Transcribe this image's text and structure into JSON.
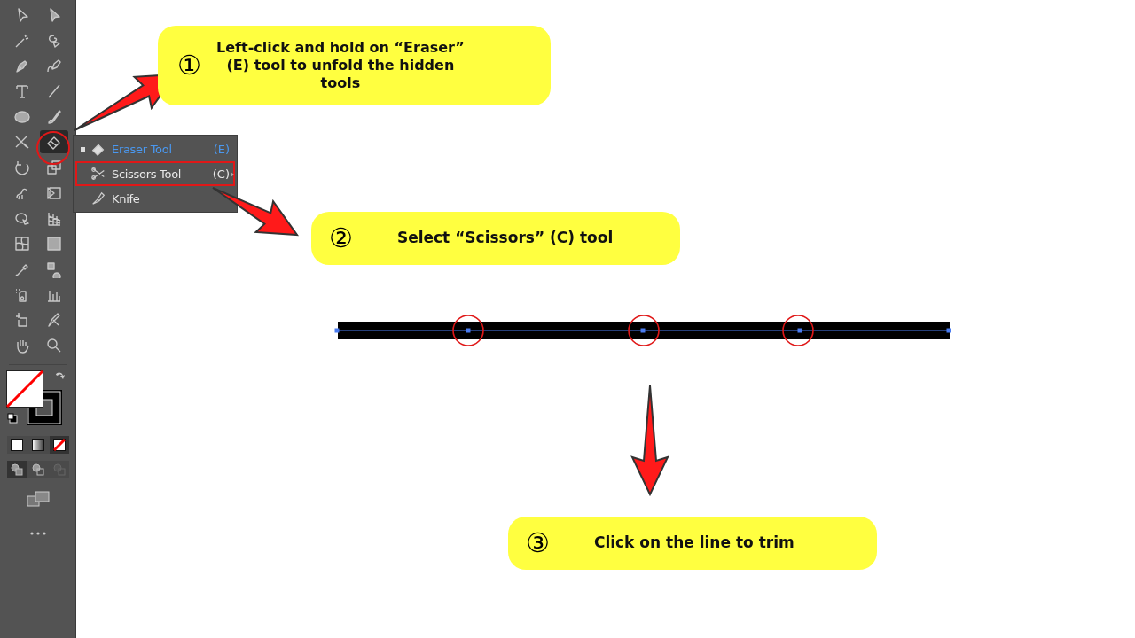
{
  "toolbar": {
    "tools": [
      {
        "kind": "select",
        "selected": false
      },
      {
        "kind": "direct-select",
        "selected": false
      },
      {
        "kind": "wand",
        "selected": false
      },
      {
        "kind": "lasso",
        "selected": false
      },
      {
        "kind": "pen",
        "selected": false
      },
      {
        "kind": "curvature",
        "selected": false
      },
      {
        "kind": "type",
        "selected": false
      },
      {
        "kind": "line",
        "selected": false
      },
      {
        "kind": "ellipse",
        "selected": false
      },
      {
        "kind": "brush",
        "selected": false
      },
      {
        "kind": "shaper",
        "selected": false
      },
      {
        "kind": "eraser",
        "selected": true
      },
      {
        "kind": "rotate",
        "selected": false
      },
      {
        "kind": "scale",
        "selected": false
      },
      {
        "kind": "warp",
        "selected": false
      },
      {
        "kind": "transform",
        "selected": false
      },
      {
        "kind": "builder",
        "selected": false
      },
      {
        "kind": "perspective",
        "selected": false
      },
      {
        "kind": "mesh",
        "selected": false
      },
      {
        "kind": "gradient",
        "selected": false
      },
      {
        "kind": "eyedropper",
        "selected": false
      },
      {
        "kind": "blend",
        "selected": false
      },
      {
        "kind": "sprayer",
        "selected": false
      },
      {
        "kind": "graph",
        "selected": false
      },
      {
        "kind": "artboard",
        "selected": false
      },
      {
        "kind": "slice",
        "selected": false
      },
      {
        "kind": "hand",
        "selected": false
      },
      {
        "kind": "zoom",
        "selected": false
      }
    ],
    "color_modes": [
      {
        "kind": "color",
        "selected": false
      },
      {
        "kind": "gradient",
        "selected": false
      },
      {
        "kind": "none",
        "selected": true
      }
    ],
    "draw_modes": [
      {
        "kind": "normal",
        "selected": true
      },
      {
        "kind": "behind",
        "selected": false
      },
      {
        "kind": "inside",
        "selected": false
      }
    ]
  },
  "flyout": {
    "items": [
      {
        "kind": "eraser",
        "label": "Eraser Tool",
        "shortcut": "(E)",
        "current": true,
        "marked": false
      },
      {
        "kind": "scissors",
        "label": "Scissors Tool",
        "shortcut": "(C)",
        "current": false,
        "marked": true
      },
      {
        "kind": "knife",
        "label": "Knife",
        "current": false,
        "marked": false
      }
    ]
  },
  "callouts": [
    {
      "number": "①",
      "text": "Left-click and hold on “Eraser” (E) tool to unfold the hidden tools"
    },
    {
      "number": "②",
      "text": "Select “Scissors” (C) tool"
    },
    {
      "number": "③",
      "text": "Click on the line to trim"
    }
  ]
}
